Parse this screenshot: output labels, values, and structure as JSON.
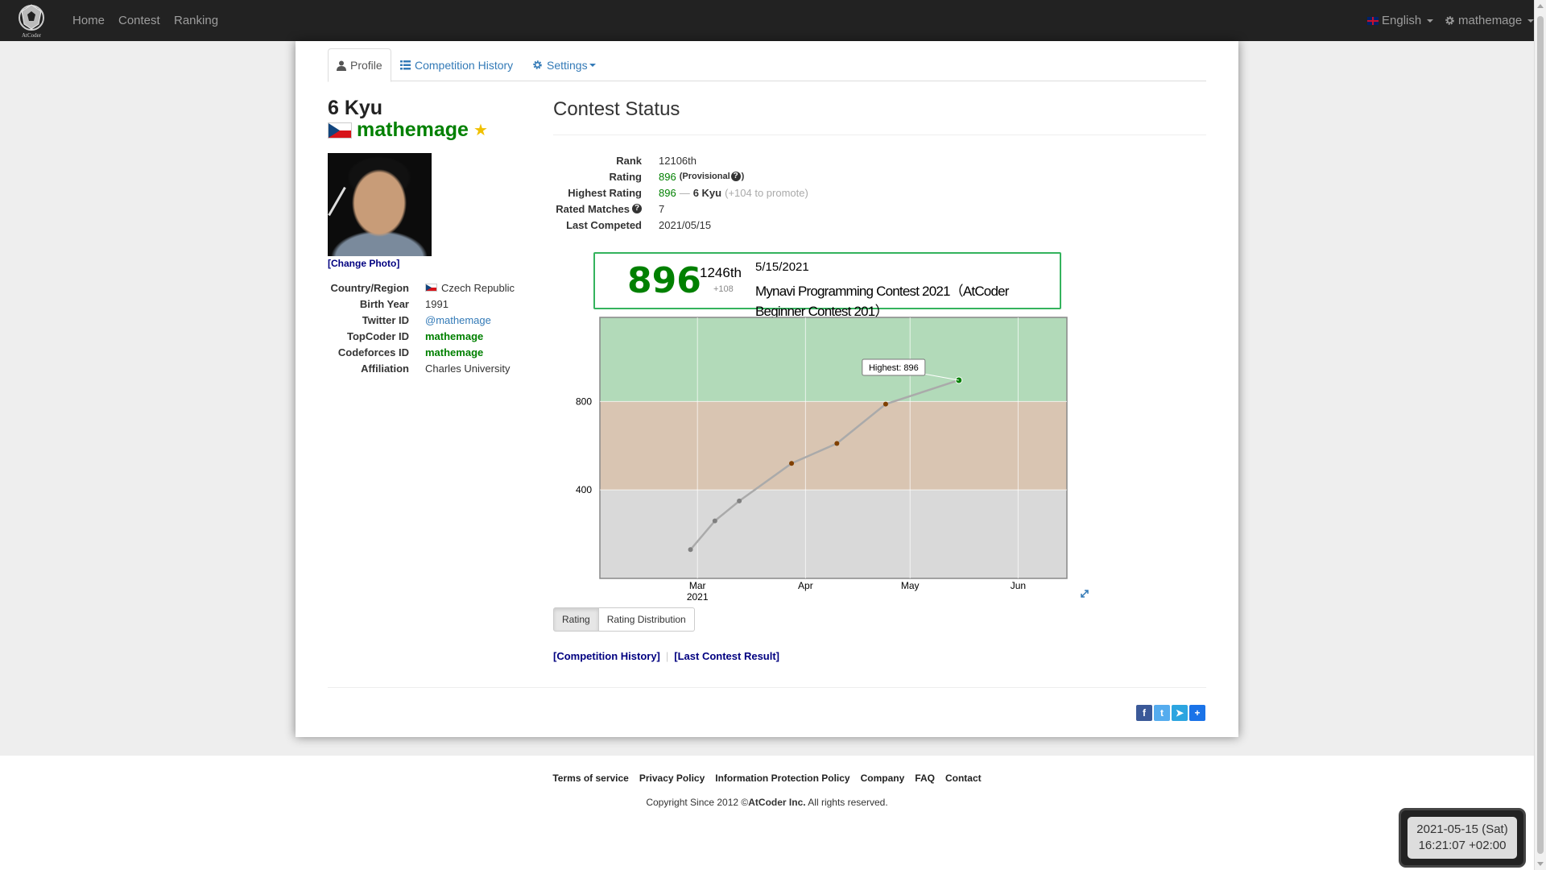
{
  "nav": {
    "brand": "AtCoder",
    "links": [
      "Home",
      "Contest",
      "Ranking"
    ],
    "language": "English",
    "user": "mathemage"
  },
  "tabs": [
    {
      "label": "Profile",
      "icon": "user-icon"
    },
    {
      "label": "Competition History",
      "icon": "list-icon"
    },
    {
      "label": "Settings",
      "icon": "gear-icon"
    }
  ],
  "profile": {
    "kyu": "6 Kyu",
    "username": "mathemage",
    "star": "★",
    "change_photo": "[Change Photo]",
    "fields": [
      {
        "label": "Country/Region",
        "value": "Czech Republic"
      },
      {
        "label": "Birth Year",
        "value": "1991"
      },
      {
        "label": "Twitter ID",
        "value": "@mathemage"
      },
      {
        "label": "TopCoder ID",
        "value": "mathemage"
      },
      {
        "label": "Codeforces ID",
        "value": "mathemage"
      },
      {
        "label": "Affiliation",
        "value": "Charles University"
      }
    ]
  },
  "contest_status": {
    "title": "Contest Status",
    "rank_label": "Rank",
    "rank": "12106th",
    "rating_label": "Rating",
    "rating": "896",
    "provisional": "(Provisional",
    "provisional_close": ")",
    "highest_label": "Highest Rating",
    "highest": "896",
    "dash": "—",
    "highest_kyu": "6 Kyu",
    "to_promote": "(+104 to promote)",
    "matches_label": "Rated Matches",
    "matches": "7",
    "last_label": "Last Competed",
    "last": "2021/05/15"
  },
  "latest_contest": {
    "rating": "896",
    "rank": "1246th",
    "diff": "+108",
    "date": "5/15/2021",
    "name": "Mynavi Programming Contest 2021（AtCoder Beginner Contest 201）"
  },
  "chart_data": {
    "type": "line",
    "x": [
      "2021-02-27",
      "2021-03-06",
      "2021-03-13",
      "2021-03-28",
      "2021-04-10",
      "2021-04-24",
      "2021-05-15"
    ],
    "series": [
      {
        "values": [
          130,
          260,
          350,
          520,
          610,
          788,
          896
        ]
      }
    ],
    "xticks": [
      "Mar",
      "Apr",
      "May",
      "Jun"
    ],
    "xtick_year": "2021",
    "yticks": [
      "400",
      "800"
    ],
    "ylim": [
      0,
      1180
    ],
    "bands": [
      {
        "from": 0,
        "to": 400,
        "color": "#d9d9d9"
      },
      {
        "from": 400,
        "to": 800,
        "color": "#d9c5b2"
      },
      {
        "from": 800,
        "to": 1200,
        "color": "#b2dab9"
      }
    ],
    "point_colors": [
      "#808080",
      "#808080",
      "#808080",
      "#804000",
      "#804000",
      "#804000",
      "#008000"
    ],
    "annotation": "Highest: 896",
    "grid": true
  },
  "graph_buttons": [
    "Rating",
    "Rating Distribution"
  ],
  "links": {
    "history": "[Competition History]",
    "last_result": "[Last Contest Result]"
  },
  "share": [
    "f",
    "t",
    "➤",
    "+"
  ],
  "footer": {
    "links": [
      "Terms of service",
      "Privacy Policy",
      "Information Protection Policy",
      "Company",
      "FAQ",
      "Contact"
    ],
    "copyright_pre": "Copyright Since 2012 ©",
    "copyright_company": "AtCoder Inc.",
    "copyright_post": " All rights reserved."
  },
  "clock": {
    "date": "2021-05-15 (Sat)",
    "time": "16:21:07 +02:00"
  },
  "colors": {
    "green": "#008000",
    "link": "#337ab7",
    "navy": "#000080",
    "nav_bg": "#222222"
  }
}
